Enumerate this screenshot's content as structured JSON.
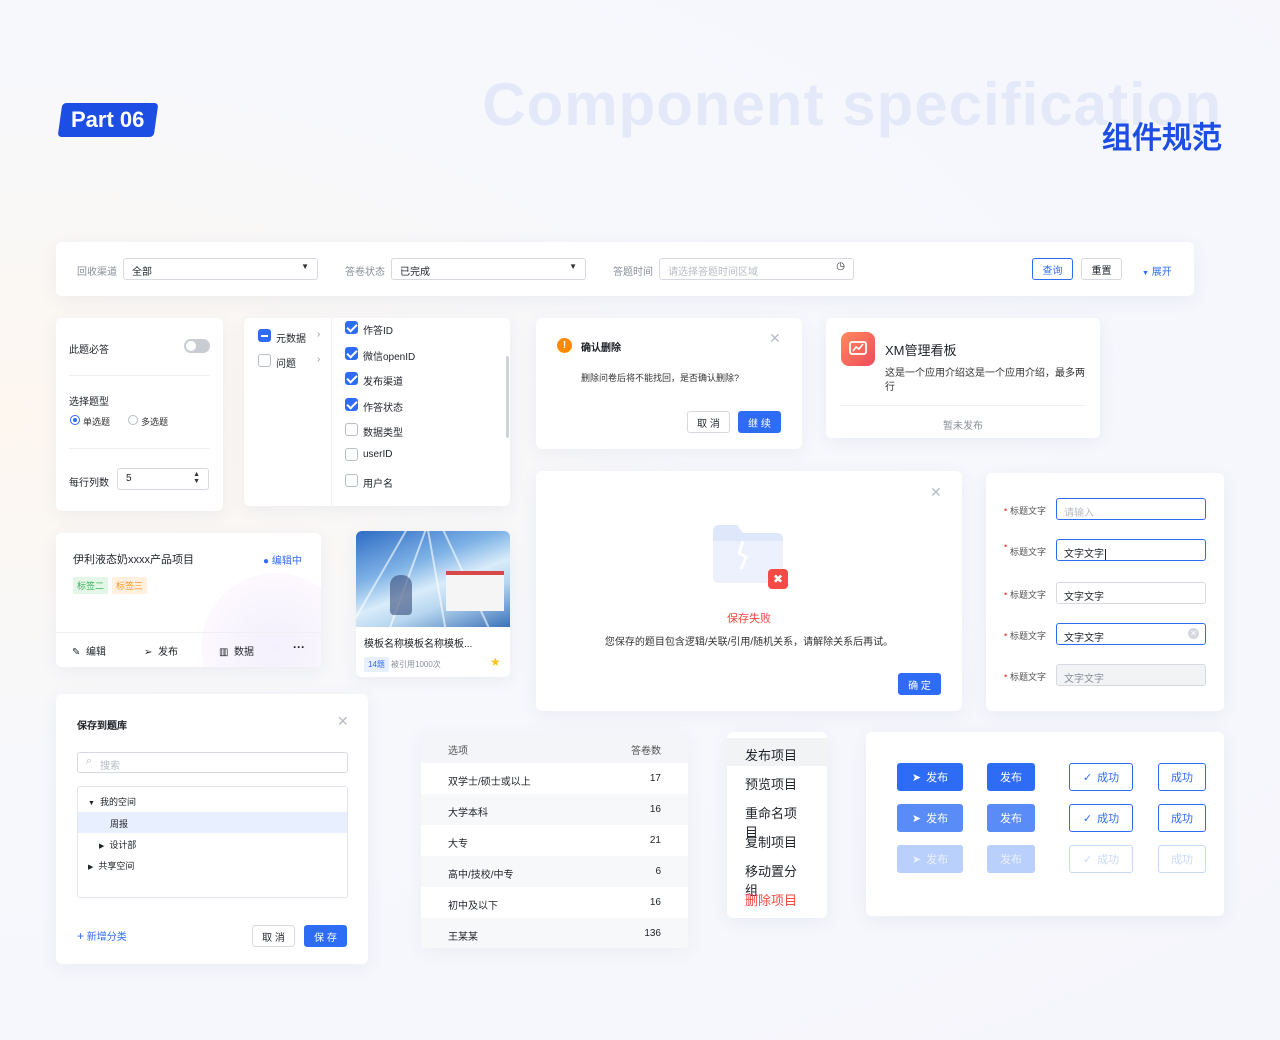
{
  "header": {
    "part_badge": "Part 06",
    "title_en": "Component specification",
    "title_cn": "组件规范"
  },
  "filter_bar": {
    "channel_label": "回收渠道",
    "channel_value": "全部",
    "status_label": "答卷状态",
    "status_value": "已完成",
    "time_label": "答题时间",
    "time_placeholder": "请选择答题时间区域",
    "query_button": "查询",
    "reset_button": "重置",
    "expand_link": "展开"
  },
  "settings_card": {
    "required_label": "此题必答",
    "required_on": false,
    "type_label": "选择题型",
    "single_choice": "单选题",
    "multi_choice": "多选题",
    "selected_type": "单选题",
    "columns_label": "每行列数",
    "columns_value": "5"
  },
  "check_tree": {
    "left_items": [
      {
        "label": "元数据",
        "state": "indeterminate"
      },
      {
        "label": "问题",
        "state": "unchecked"
      }
    ],
    "right_items": [
      {
        "label": "作答ID",
        "checked": true
      },
      {
        "label": "微信openID",
        "checked": true
      },
      {
        "label": "发布渠道",
        "checked": true
      },
      {
        "label": "作答状态",
        "checked": true
      },
      {
        "label": "数据类型",
        "checked": false
      },
      {
        "label": "userID",
        "checked": false
      },
      {
        "label": "用户名",
        "checked": false
      }
    ]
  },
  "confirm_modal": {
    "title": "确认删除",
    "message": "删除问卷后将不能找回，是否确认删除?",
    "cancel": "取 消",
    "continue": "继 续"
  },
  "app_card": {
    "name": "XM管理看板",
    "description": "这是一个应用介绍这是一个应用介绍，最多两行",
    "status": "暂未发布"
  },
  "project_card": {
    "title": "伊利液态奶xxxx产品项目",
    "status": "编辑中",
    "tags": [
      "标签二",
      "标签三"
    ],
    "actions": {
      "edit": "编辑",
      "publish": "发布",
      "data": "数据",
      "more": "···"
    }
  },
  "template_card": {
    "title": "模板名称模板名称模板...",
    "badge": "14题",
    "usage": "被引用1000次"
  },
  "fail_modal": {
    "title": "保存失败",
    "message": "您保存的题目包含逻辑/关联/引用/随机关系，请解除关系后再试。",
    "ok": "确 定"
  },
  "form_fields": {
    "label": "标题文字",
    "fields": [
      {
        "placeholder": "请输入",
        "value": "",
        "state": "focus-empty"
      },
      {
        "placeholder": "",
        "value": "文字文字",
        "state": "typing"
      },
      {
        "placeholder": "",
        "value": "文字文字",
        "state": "normal"
      },
      {
        "placeholder": "",
        "value": "文字文字",
        "state": "clearable"
      },
      {
        "placeholder": "",
        "value": "文字文字",
        "state": "disabled"
      }
    ]
  },
  "save_library": {
    "title": "保存到题库",
    "search_placeholder": "搜索",
    "tree": [
      {
        "label": "我的空间",
        "level": 0,
        "expanded": true
      },
      {
        "label": "周报",
        "level": 1,
        "selected": true
      },
      {
        "label": "设计部",
        "level": 1,
        "expanded": false
      },
      {
        "label": "共享空间",
        "level": 0,
        "expanded": false
      }
    ],
    "add_category": "新增分类",
    "cancel": "取 消",
    "save": "保 存"
  },
  "table": {
    "headers": [
      "选项",
      "答卷数"
    ],
    "rows": [
      [
        "双学士/硕士或以上",
        "17"
      ],
      [
        "大学本科",
        "16"
      ],
      [
        "大专",
        "21"
      ],
      [
        "高中/技校/中专",
        "6"
      ],
      [
        "初中及以下",
        "16"
      ],
      [
        "王某某",
        "136"
      ]
    ]
  },
  "context_menu": {
    "items": [
      "发布项目",
      "预览项目",
      "重命名项目",
      "复制项目",
      "移动置分组",
      "删除项目"
    ]
  },
  "button_states": {
    "publish": "发布",
    "success": "成功"
  },
  "colors": {
    "primary": "#2f6cf6",
    "brand_dark": "#1d4ee3",
    "danger": "#f54a45",
    "warning": "#ff8a00"
  }
}
